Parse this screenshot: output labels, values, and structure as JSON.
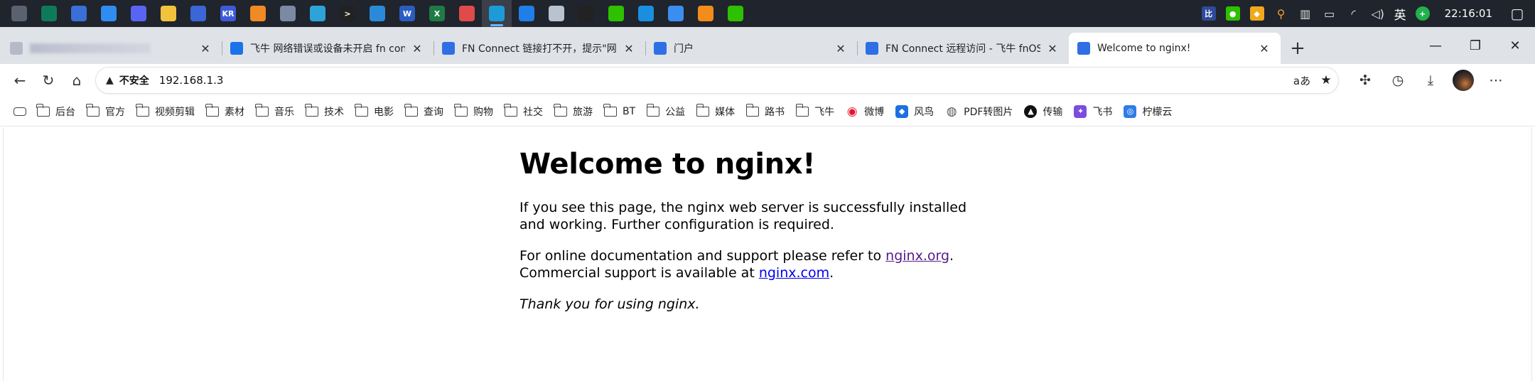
{
  "taskbar": {
    "apps": [
      {
        "icon": "generic-app-icon",
        "color": "#5a6270",
        "glyph": ""
      },
      {
        "icon": "green-app-icon",
        "color": "#0f7a5a",
        "glyph": ""
      },
      {
        "icon": "blue-grid-app-icon",
        "color": "#3b6fd8",
        "glyph": ""
      },
      {
        "icon": "blue-star-app-icon",
        "color": "#2f8cf0",
        "glyph": ""
      },
      {
        "icon": "discord-like-app-icon",
        "color": "#5865f2",
        "glyph": ""
      },
      {
        "icon": "file-explorer-icon",
        "color": "#f3c23c",
        "glyph": ""
      },
      {
        "icon": "blue-gear-app-icon",
        "color": "#3a66d8",
        "glyph": ""
      },
      {
        "icon": "kr-app-icon",
        "color": "#3d5bd9",
        "glyph": "KR"
      },
      {
        "icon": "orange-app-icon",
        "color": "#f08a24",
        "glyph": ""
      },
      {
        "icon": "notes-app-icon",
        "color": "#7a8aa3",
        "glyph": ""
      },
      {
        "icon": "globe-app-icon",
        "color": "#2ea3d8",
        "glyph": ""
      },
      {
        "icon": "terminal-app-icon",
        "color": "#222222",
        "glyph": ">"
      },
      {
        "icon": "vscode-icon",
        "color": "#2a8ad8",
        "glyph": ""
      },
      {
        "icon": "word-icon",
        "color": "#2b5cc2",
        "glyph": "W"
      },
      {
        "icon": "excel-icon",
        "color": "#1f7b44",
        "glyph": "X"
      },
      {
        "icon": "red-app-icon",
        "color": "#e04a4a",
        "glyph": ""
      },
      {
        "icon": "edge-browser-icon",
        "color": "#1d9bd8",
        "glyph": ""
      },
      {
        "icon": "blue-circle-app-icon",
        "color": "#1f7ee8",
        "glyph": ""
      },
      {
        "icon": "avatar-app-icon",
        "color": "#b9c2cf",
        "glyph": ""
      },
      {
        "icon": "qq-icon",
        "color": "#222222",
        "glyph": ""
      },
      {
        "icon": "wechat-icon",
        "color": "#2dc100",
        "glyph": ""
      },
      {
        "icon": "edge-dev-icon",
        "color": "#1a8fe0",
        "glyph": ""
      },
      {
        "icon": "bird-app-icon",
        "color": "#3b8ef0",
        "glyph": ""
      },
      {
        "icon": "orange-square-app-icon",
        "color": "#f28c1a",
        "glyph": ""
      },
      {
        "icon": "wechat-work-icon",
        "color": "#2dc100",
        "glyph": ""
      }
    ],
    "active_index": 16,
    "tray": {
      "ime_label": "英",
      "clock": "22:16:01"
    }
  },
  "tabs": [
    {
      "title": "",
      "blurred": true,
      "favicon": "blurred-favicon-icon",
      "favicon_color": "#b6b9c8"
    },
    {
      "title": "飞牛 网络错误或设备未开启 fn con",
      "favicon": "search-favicon-icon",
      "favicon_color": "#1a73e8"
    },
    {
      "title": "FN Connect 链接打不开，提示\"网",
      "favicon": "fn-favicon-icon",
      "favicon_color": "#2f6fe6"
    },
    {
      "title": "门户",
      "favicon": "fn-favicon-icon",
      "favicon_color": "#2f6fe6"
    },
    {
      "title": "FN Connect 远程访问 - 飞牛 fnOS",
      "favicon": "fn-favicon-icon",
      "favicon_color": "#2f6fe6"
    },
    {
      "title": "Welcome to nginx!",
      "favicon": "fn-favicon-icon",
      "favicon_color": "#2f6fe6",
      "active": true
    }
  ],
  "addressbar": {
    "security_label": "不安全",
    "url": "192.168.1.3"
  },
  "bookmarks": [
    {
      "label": "后台",
      "type": "folder"
    },
    {
      "label": "官方",
      "type": "folder"
    },
    {
      "label": "视频剪辑",
      "type": "folder"
    },
    {
      "label": "素材",
      "type": "folder"
    },
    {
      "label": "音乐",
      "type": "folder"
    },
    {
      "label": "技术",
      "type": "folder"
    },
    {
      "label": "电影",
      "type": "folder"
    },
    {
      "label": "查询",
      "type": "folder"
    },
    {
      "label": "购物",
      "type": "folder"
    },
    {
      "label": "社交",
      "type": "folder"
    },
    {
      "label": "旅游",
      "type": "folder"
    },
    {
      "label": "BT",
      "type": "folder"
    },
    {
      "label": "公益",
      "type": "folder"
    },
    {
      "label": "媒体",
      "type": "folder"
    },
    {
      "label": "路书",
      "type": "folder"
    },
    {
      "label": "飞牛",
      "type": "folder"
    },
    {
      "label": "微博",
      "type": "site",
      "icon": "weibo-icon",
      "color": "#e6162d"
    },
    {
      "label": "风鸟",
      "type": "site",
      "icon": "shield-icon",
      "color": "#1e6fe0"
    },
    {
      "label": "PDF转图片",
      "type": "site",
      "icon": "globe-icon",
      "color": "#555555"
    },
    {
      "label": "传输",
      "type": "site",
      "icon": "transfer-icon",
      "color": "#111111"
    },
    {
      "label": "飞书",
      "type": "site",
      "icon": "feishu-icon",
      "color": "#7b4ce0"
    },
    {
      "label": "柠檬云",
      "type": "site",
      "icon": "lemon-cloud-icon",
      "color": "#2f7be8"
    }
  ],
  "page": {
    "heading": "Welcome to nginx!",
    "p1": "If you see this page, the nginx web server is successfully installed and working. Further configuration is required.",
    "p2_prefix": "For online documentation and support please refer to ",
    "p2_link1": "nginx.org",
    "p2_mid": ".",
    "p2_line2_prefix": "Commercial support is available at ",
    "p2_link2": "nginx.com",
    "p2_suffix": ".",
    "p3": "Thank you for using nginx."
  }
}
